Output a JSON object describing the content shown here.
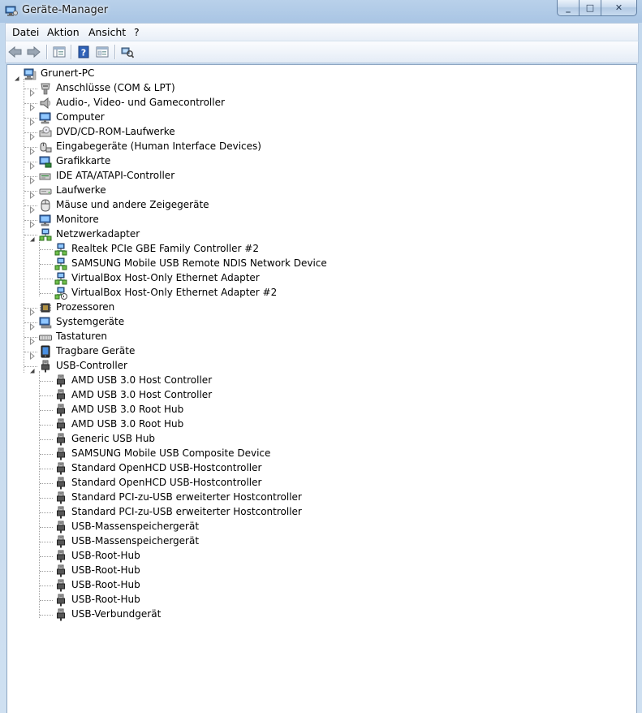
{
  "window": {
    "title": "Geräte-Manager",
    "minimize": "_",
    "maximize": "□",
    "close": "✕"
  },
  "menu": [
    {
      "id": "file",
      "label": "Datei"
    },
    {
      "id": "action",
      "label": "Aktion"
    },
    {
      "id": "view",
      "label": "Ansicht"
    },
    {
      "id": "help",
      "label": "?"
    }
  ],
  "toolbar": {
    "buttons": [
      {
        "name": "back-button",
        "icon": "arrow-left-icon"
      },
      {
        "name": "forward-button",
        "icon": "arrow-right-icon"
      },
      {
        "name": "show-hide-console-tree-button",
        "icon": "console-tree-icon"
      },
      {
        "name": "help-button",
        "icon": "help-icon"
      },
      {
        "name": "properties-button",
        "icon": "properties-icon"
      },
      {
        "name": "scan-hardware-button",
        "icon": "scan-hardware-icon"
      }
    ]
  },
  "tree": {
    "root": {
      "label": "Grunert-PC",
      "icon": "computer-icon",
      "expanded": true
    },
    "categories": [
      {
        "label": "Anschlüsse (COM & LPT)",
        "icon": "port-icon",
        "expanded": false,
        "children": []
      },
      {
        "label": "Audio-, Video- und Gamecontroller",
        "icon": "speaker-icon",
        "expanded": false,
        "children": []
      },
      {
        "label": "Computer",
        "icon": "monitor-icon",
        "expanded": false,
        "children": []
      },
      {
        "label": "DVD/CD-ROM-Laufwerke",
        "icon": "dvd-drive-icon",
        "expanded": false,
        "children": []
      },
      {
        "label": "Eingabegeräte (Human Interface Devices)",
        "icon": "hid-icon",
        "expanded": false,
        "children": []
      },
      {
        "label": "Grafikkarte",
        "icon": "display-adapter-icon",
        "expanded": false,
        "children": []
      },
      {
        "label": "IDE ATA/ATAPI-Controller",
        "icon": "ide-controller-icon",
        "expanded": false,
        "children": []
      },
      {
        "label": "Laufwerke",
        "icon": "disk-drive-icon",
        "expanded": false,
        "children": []
      },
      {
        "label": "Mäuse und andere Zeigegeräte",
        "icon": "mouse-icon",
        "expanded": false,
        "children": []
      },
      {
        "label": "Monitore",
        "icon": "monitor-icon",
        "expanded": false,
        "children": []
      },
      {
        "label": "Netzwerkadapter",
        "icon": "network-adapter-icon",
        "expanded": true,
        "children": [
          {
            "label": "Realtek PCIe GBE Family Controller #2",
            "icon": "network-adapter-icon"
          },
          {
            "label": "SAMSUNG Mobile USB Remote NDIS Network Device",
            "icon": "network-adapter-icon"
          },
          {
            "label": "VirtualBox Host-Only Ethernet Adapter",
            "icon": "network-adapter-icon"
          },
          {
            "label": "VirtualBox Host-Only Ethernet Adapter #2",
            "icon": "network-adapter-warning-icon"
          }
        ]
      },
      {
        "label": "Prozessoren",
        "icon": "processor-icon",
        "expanded": false,
        "children": []
      },
      {
        "label": "Systemgeräte",
        "icon": "system-device-icon",
        "expanded": false,
        "children": []
      },
      {
        "label": "Tastaturen",
        "icon": "keyboard-icon",
        "expanded": false,
        "children": []
      },
      {
        "label": "Tragbare Geräte",
        "icon": "portable-device-icon",
        "expanded": false,
        "children": []
      },
      {
        "label": "USB-Controller",
        "icon": "usb-icon",
        "expanded": true,
        "children": [
          {
            "label": "AMD USB 3.0 Host Controller",
            "icon": "usb-icon"
          },
          {
            "label": "AMD USB 3.0 Host Controller",
            "icon": "usb-icon"
          },
          {
            "label": "AMD USB 3.0 Root Hub",
            "icon": "usb-icon"
          },
          {
            "label": "AMD USB 3.0 Root Hub",
            "icon": "usb-icon"
          },
          {
            "label": "Generic USB Hub",
            "icon": "usb-icon"
          },
          {
            "label": "SAMSUNG Mobile USB Composite Device",
            "icon": "usb-icon"
          },
          {
            "label": "Standard OpenHCD USB-Hostcontroller",
            "icon": "usb-icon"
          },
          {
            "label": "Standard OpenHCD USB-Hostcontroller",
            "icon": "usb-icon"
          },
          {
            "label": "Standard PCI-zu-USB erweiterter Hostcontroller",
            "icon": "usb-icon"
          },
          {
            "label": "Standard PCI-zu-USB erweiterter Hostcontroller",
            "icon": "usb-icon"
          },
          {
            "label": "USB-Massenspeichergerät",
            "icon": "usb-icon"
          },
          {
            "label": "USB-Massenspeichergerät",
            "icon": "usb-icon"
          },
          {
            "label": "USB-Root-Hub",
            "icon": "usb-icon"
          },
          {
            "label": "USB-Root-Hub",
            "icon": "usb-icon"
          },
          {
            "label": "USB-Root-Hub",
            "icon": "usb-icon"
          },
          {
            "label": "USB-Root-Hub",
            "icon": "usb-icon"
          },
          {
            "label": "USB-Verbundgerät",
            "icon": "usb-icon"
          }
        ]
      }
    ]
  }
}
